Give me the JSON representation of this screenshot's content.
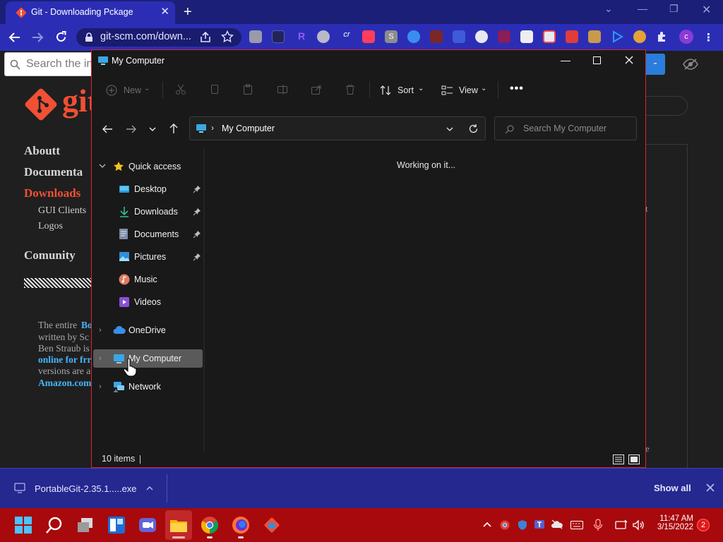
{
  "browser": {
    "tab_title": "Git - Downloading Pckage",
    "url": "git-scm.com/down...",
    "profile_initial": "c"
  },
  "webpage": {
    "search_placeholder": "Search the in",
    "logo_text": "git",
    "nav": [
      "Aboutt",
      "Documenta",
      "Downloads",
      "Comunity"
    ],
    "sub_nav": [
      "GUI Clients",
      "Logos"
    ],
    "book_lines": [
      "The entire",
      "Bo",
      "written by Sc",
      "Ben Straub is",
      "online for frr",
      "versions are a",
      "Amazon.com"
    ],
    "right_fragments": [
      "t",
      "e"
    ]
  },
  "explorer": {
    "title": "My Computer",
    "commands": {
      "new": "New",
      "sort": "Sort",
      "view": "View"
    },
    "address": "My Computer",
    "search_placeholder": "Search My Computer",
    "nav_items": [
      {
        "label": "Quick access"
      },
      {
        "label": "Desktop"
      },
      {
        "label": "Downloads"
      },
      {
        "label": "Documents"
      },
      {
        "label": "Pictures"
      },
      {
        "label": "Music"
      },
      {
        "label": "Videos"
      },
      {
        "label": "OneDrive"
      },
      {
        "label": "My Computer"
      },
      {
        "label": "Network"
      }
    ],
    "content_status": "Working on it...",
    "status_count": "10 items"
  },
  "downloads": {
    "filename": "PortableGit-2.35.1.....exe",
    "show_all": "Show all"
  },
  "taskbar": {
    "time": "11:47 AM",
    "date": "3/15/2022",
    "notification_count": "2"
  },
  "colors": {
    "chrome_theme": "#2b2eb5",
    "taskbar": "#a8090c",
    "explorer_border": "#d9232e",
    "git_brand": "#f05033"
  }
}
